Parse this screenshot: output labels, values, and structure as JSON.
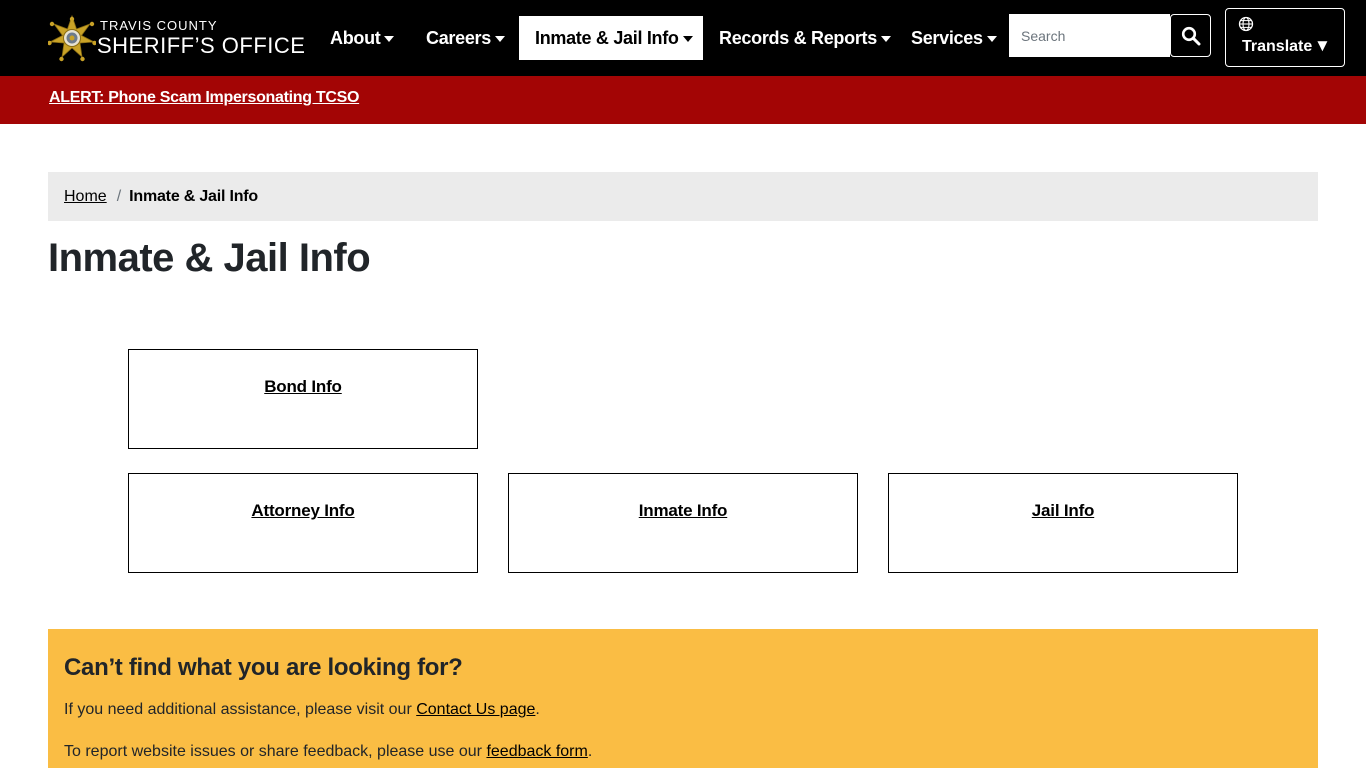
{
  "header": {
    "logo_line1": "TRAVIS COUNTY",
    "logo_line2": "SHERIFF’S OFFICE",
    "nav": [
      {
        "label": "About"
      },
      {
        "label": "Careers"
      },
      {
        "label": "Inmate & Jail Info",
        "active": true
      },
      {
        "label": "Records & Reports"
      },
      {
        "label": "Services"
      }
    ],
    "search_placeholder": "Search",
    "translate_label": "Translate",
    "translate_arrow": "▼"
  },
  "alert": {
    "text": "ALERT: Phone Scam Impersonating TCSO"
  },
  "breadcrumb": {
    "home": "Home",
    "separator": "/",
    "current": "Inmate & Jail Info"
  },
  "page_title": "Inmate & Jail Info",
  "cards": [
    {
      "label": "Bond Info"
    },
    {
      "label": "Attorney Info"
    },
    {
      "label": "Inmate Info"
    },
    {
      "label": "Jail Info"
    }
  ],
  "help": {
    "title": "Can’t find what you are looking for?",
    "p1_before": "If you need additional assistance, please visit our ",
    "p1_link": "Contact Us page",
    "p1_after": ".",
    "p2_before": "To report website issues or share feedback, please use our ",
    "p2_link": "feedback form",
    "p2_after": "."
  },
  "colors": {
    "header_bg": "#000000",
    "alert_bg": "#a30505",
    "breadcrumb_bg": "#ebebeb",
    "help_bg": "#fabd44",
    "badge_gold": "#c9a227"
  }
}
